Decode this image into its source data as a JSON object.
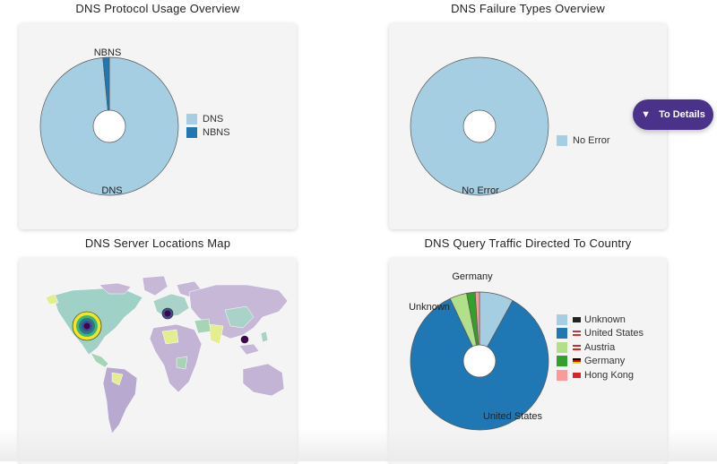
{
  "panels": {
    "protocol": {
      "title": "DNS Protocol Usage Overview",
      "legend": [
        "DNS",
        "NBNS"
      ]
    },
    "failures": {
      "title": "DNS Failure Types Overview",
      "legend": [
        "No Error"
      ]
    },
    "map": {
      "title": "DNS Server Locations Map"
    },
    "traffic": {
      "title": "DNS Query Traffic Directed To Country",
      "legend": [
        "Unknown",
        "United States",
        "Austria",
        "Germany",
        "Hong Kong"
      ]
    }
  },
  "to_details_button": {
    "label": "To Details",
    "icon": "triangle-down-icon"
  },
  "colors": {
    "light_blue": "#a6cee3",
    "dark_blue": "#1f78b4",
    "light_green": "#b2df8a",
    "dark_green": "#33a02c",
    "pink": "#fb9a99",
    "button": "#4a3189"
  },
  "chart_data": [
    {
      "type": "pie",
      "title": "DNS Protocol Usage Overview",
      "categories": [
        "DNS",
        "NBNS"
      ],
      "values": [
        98.5,
        1.5
      ],
      "slice_labels": [
        "DNS",
        "NBNS"
      ],
      "legend": "right"
    },
    {
      "type": "pie",
      "title": "DNS Failure Types Overview",
      "categories": [
        "No Error"
      ],
      "values": [
        100
      ],
      "slice_labels": [
        "No Error"
      ],
      "legend": "right"
    },
    {
      "type": "pie",
      "title": "DNS Query Traffic Directed To Country",
      "categories": [
        "Unknown",
        "United States",
        "Austria",
        "Germany",
        "Hong Kong"
      ],
      "values": [
        8,
        85,
        4,
        2,
        1
      ],
      "slice_labels": [
        "Unknown",
        "United States",
        "",
        "Germany",
        ""
      ],
      "legend": "right"
    }
  ]
}
